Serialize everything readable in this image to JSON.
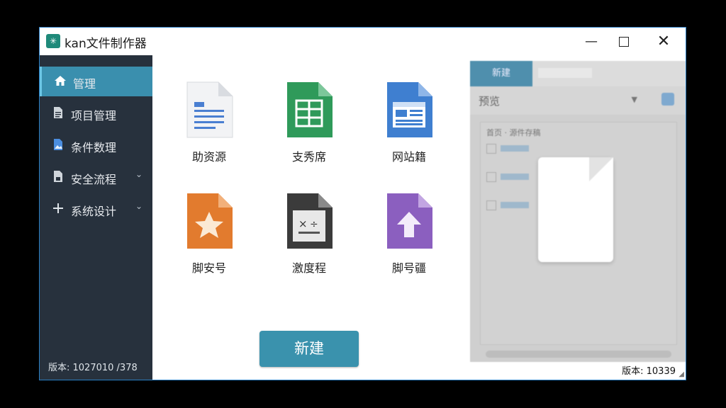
{
  "window": {
    "title": "kan文件制作器",
    "app_icon": "✳",
    "minimize": "—",
    "close": "✕"
  },
  "sidebar": {
    "items": [
      {
        "label": "管理",
        "icon": "home-icon",
        "active": true
      },
      {
        "label": "项目管理",
        "icon": "document-icon"
      },
      {
        "label": "条件数理",
        "icon": "image-file-icon"
      },
      {
        "label": "安全流程",
        "icon": "lock-file-icon",
        "has_chevron": true
      },
      {
        "label": "系统设计",
        "icon": "plus-icon",
        "has_chevron": true
      }
    ],
    "version": "版本: 1027010 /378"
  },
  "main": {
    "tiles": [
      {
        "name": "助资源",
        "icon": "document-text-icon",
        "color": "#4a7fd1"
      },
      {
        "name": "支秀席",
        "icon": "spreadsheet-icon",
        "color": "#2f9a5a"
      },
      {
        "name": "网站籍",
        "icon": "web-page-icon",
        "color": "#3f7fd0"
      },
      {
        "name": "脚安号",
        "icon": "star-file-icon",
        "color": "#e27b2e"
      },
      {
        "name": "激度程",
        "icon": "formula-file-icon",
        "color": "#3b3b3b"
      },
      {
        "name": "脚号疆",
        "icon": "upload-file-icon",
        "color": "#8b5fbf"
      }
    ],
    "new_button": "新建"
  },
  "preview": {
    "tab_active": "新建",
    "title": "预览",
    "list_header": "首页 · 源件存稿"
  },
  "footer": {
    "version": "版本: 10339"
  },
  "colors": {
    "sidebar_bg": "#27313d",
    "active_item": "#3a8fae",
    "accent": "#3a92ad"
  }
}
